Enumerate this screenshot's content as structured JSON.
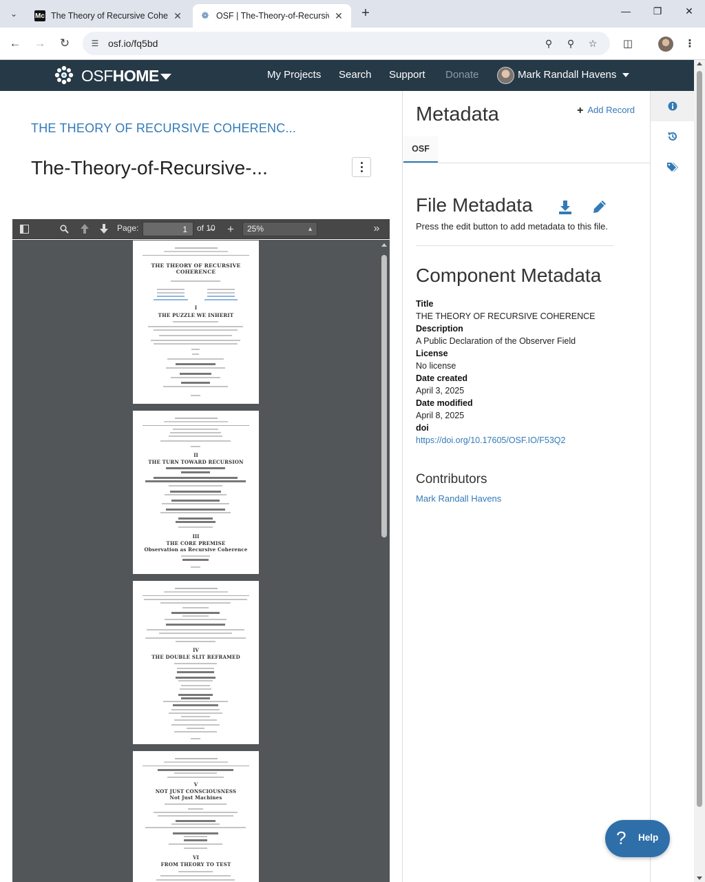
{
  "browser": {
    "tabs": [
      {
        "favicon": "Mc",
        "title": "The Theory of Recursive Cohere",
        "active": false
      },
      {
        "favicon": "osf-icon",
        "title": "OSF | The-Theory-of-Recursive-",
        "active": true
      }
    ],
    "url": "osf.io/fq5bd"
  },
  "osf_nav": {
    "brand_light": "OSF",
    "brand_bold": "HOME",
    "links": [
      "My Projects",
      "Search",
      "Support",
      "Donate"
    ],
    "user_name": "Mark Randall Havens"
  },
  "file_view": {
    "project_title": "THE THEORY OF RECURSIVE COHERENC...",
    "file_title": "The-Theory-of-Recursive-..."
  },
  "pdf_viewer": {
    "page_label": "Page:",
    "current_page": "1",
    "of_pages": "of 10",
    "zoom": "25%",
    "pages": [
      {
        "title": "THE THEORY OF RECURSIVE COHERENCE",
        "section": "I",
        "section_title": "THE PUZZLE WE INHERIT"
      },
      {
        "section": "II",
        "section_title": "THE TURN TOWARD RECURSION",
        "section2": "III",
        "section2_title": "THE CORE PREMISE",
        "section2_sub": "Observation as Recursive Coherence"
      },
      {
        "section": "IV",
        "section_title": "THE DOUBLE SLIT REFRAMED"
      },
      {
        "section": "V",
        "section_title": "NOT JUST CONSCIOUSNESS",
        "section_sub": "Not Just Machines",
        "section2": "VI",
        "section2_title": "FROM THEORY TO TEST"
      }
    ]
  },
  "metadata": {
    "heading": "Metadata",
    "add_record": "Add Record",
    "tab": "OSF",
    "file_metadata_heading": "File Metadata",
    "file_metadata_hint": "Press the edit button to add metadata to this file.",
    "component_metadata_heading": "Component Metadata",
    "fields": {
      "title_label": "Title",
      "title_value": "THE THEORY OF RECURSIVE COHERENCE",
      "description_label": "Description",
      "description_value": "A Public Declaration of the Observer Field",
      "license_label": "License",
      "license_value": "No license",
      "created_label": "Date created",
      "created_value": "April 3, 2025",
      "modified_label": "Date modified",
      "modified_value": "April 8, 2025",
      "doi_label": "doi",
      "doi_value": "https://doi.org/10.17605/OSF.IO/F53Q2"
    },
    "contributors_heading": "Contributors",
    "contributors": [
      "Mark Randall Havens"
    ]
  },
  "help": {
    "label": "Help"
  },
  "colors": {
    "osf_navbar": "#263947",
    "link": "#337ab7",
    "help_button": "#2f6fa9",
    "pdf_toolbar": "#474747",
    "pdf_background": "#525659"
  }
}
